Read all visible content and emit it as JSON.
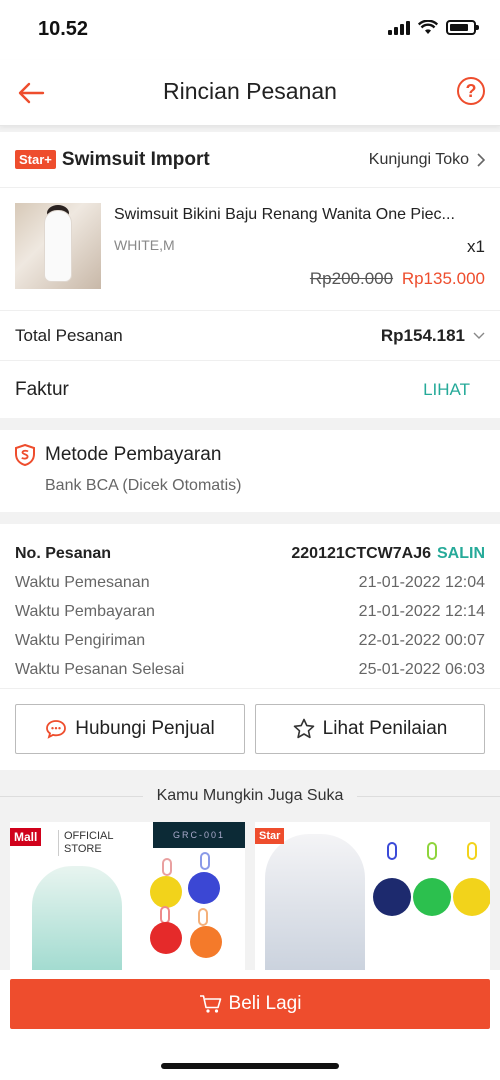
{
  "status_bar": {
    "time": "10.52"
  },
  "header": {
    "title": "Rincian Pesanan",
    "help_label": "?"
  },
  "shop": {
    "badge": "Star+",
    "name": "Swimsuit Import",
    "visit_label": "Kunjungi Toko"
  },
  "product": {
    "name": "Swimsuit Bikini Baju Renang Wanita One Piec...",
    "variant": "WHITE,M",
    "quantity": "x1",
    "original_price": "Rp200.000",
    "price": "Rp135.000"
  },
  "total": {
    "label": "Total Pesanan",
    "value": "Rp154.181"
  },
  "invoice": {
    "label": "Faktur",
    "action": "LIHAT"
  },
  "payment": {
    "title": "Metode Pembayaran",
    "method": "Bank BCA (Dicek Otomatis)"
  },
  "order": {
    "number_label": "No. Pesanan",
    "number": "220121CTCW7AJ6",
    "copy_label": "SALIN",
    "rows": [
      {
        "label": "Waktu Pemesanan",
        "value": "21-01-2022 12:04"
      },
      {
        "label": "Waktu Pembayaran",
        "value": "21-01-2022 12:14"
      },
      {
        "label": "Waktu Pengiriman",
        "value": "22-01-2022 00:07"
      },
      {
        "label": "Waktu Pesanan Selesai",
        "value": "25-01-2022 06:03"
      }
    ]
  },
  "actions": {
    "contact_seller": "Hubungi Penjual",
    "view_review": "Lihat Penilaian"
  },
  "recommendations": {
    "title": "Kamu Mungkin Juga Suka",
    "items": [
      {
        "badge": "Mall",
        "store_label": "OFFICIAL STORE",
        "image_text": "GRC-001"
      },
      {
        "badge": "Star"
      }
    ]
  },
  "bottom": {
    "buy_again": "Beli Lagi"
  },
  "colors": {
    "accent": "#ee4d2d",
    "teal": "#26aa99"
  }
}
